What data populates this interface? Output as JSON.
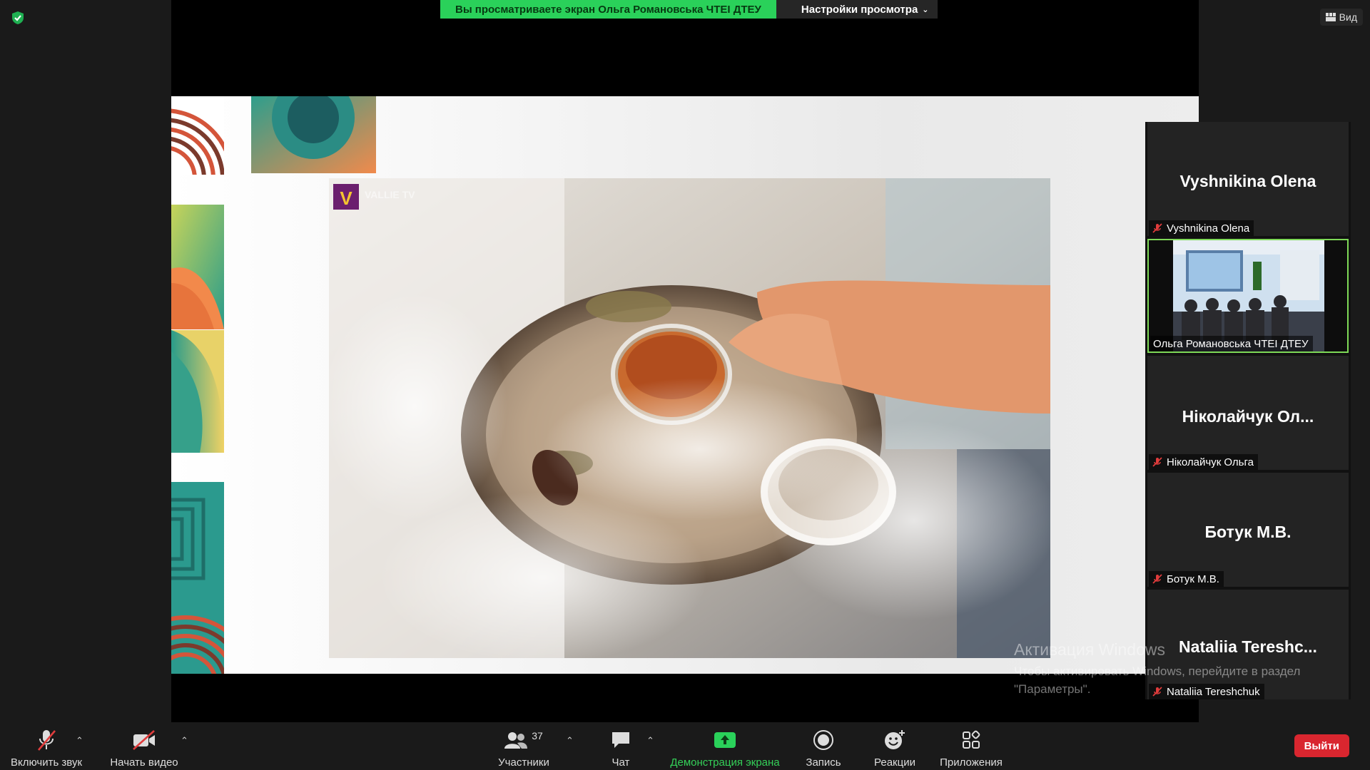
{
  "banner": {
    "share_text": "Вы просматриваете экран Ольга Романовська ЧТЕІ ДТЕУ",
    "view_options_label": "Настройки просмотра"
  },
  "view_button_label": "Вид",
  "shared_photo_watermark": "VALLIE TV",
  "gallery": {
    "tiles": [
      {
        "big_name": "Vyshnikina Olena",
        "label": "Vyshnikina Olena",
        "muted": true
      },
      {
        "big_name": "",
        "label": "Ольга Романовська ЧТЕІ ДТЕУ",
        "muted": false,
        "active_speaker": true
      },
      {
        "big_name": "Ніколайчук  Ол...",
        "label": "Ніколайчук Ольга",
        "muted": true
      },
      {
        "big_name": "Ботук М.В.",
        "label": "Ботук М.В.",
        "muted": true
      },
      {
        "big_name": "Nataliia  Tereshc...",
        "label": "Nataliia Tereshchuk",
        "muted": true
      }
    ]
  },
  "watermark": {
    "title": "Активация Windows",
    "line1": "Чтобы активировать Windows, перейдите в раздел",
    "line2": "\"Параметры\"."
  },
  "toolbar": {
    "unmute_label": "Включить звук",
    "start_video_label": "Начать видео",
    "participants_label": "Участники",
    "participants_count": "37",
    "chat_label": "Чат",
    "share_label": "Демонстрация экрана",
    "record_label": "Запись",
    "reactions_label": "Реакции",
    "apps_label": "Приложения",
    "leave_label": "Выйти"
  },
  "colors": {
    "share_green": "#2ad15a",
    "active_border": "#7ed957",
    "leave_red": "#d9262f"
  }
}
